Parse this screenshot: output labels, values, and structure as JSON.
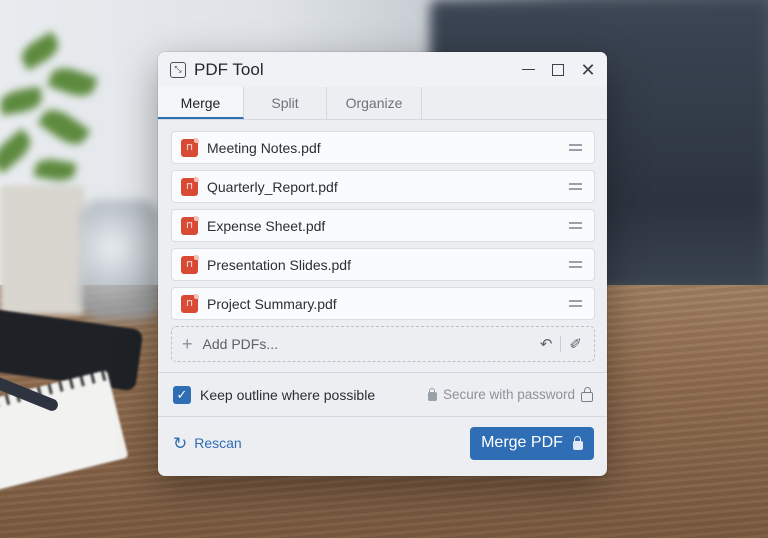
{
  "window": {
    "title": "PDF Tool"
  },
  "tabs": [
    {
      "label": "Merge",
      "active": true
    },
    {
      "label": "Split",
      "active": false
    },
    {
      "label": "Organize",
      "active": false
    }
  ],
  "files": [
    {
      "name": "Meeting Notes.pdf"
    },
    {
      "name": "Quarterly_Report.pdf"
    },
    {
      "name": "Expense Sheet.pdf"
    },
    {
      "name": "Presentation Slides.pdf"
    },
    {
      "name": "Project Summary.pdf"
    }
  ],
  "add": {
    "label": "Add PDFs..."
  },
  "options": {
    "keep_outline_label": "Keep outline where possible",
    "keep_outline_checked": true,
    "secure_label": "Secure with password"
  },
  "footer": {
    "rescan_label": "Rescan",
    "merge_label": "Merge PDF"
  },
  "colors": {
    "accent": "#2f6db5",
    "pdf_icon": "#d94a35"
  },
  "icons": [
    "pdf-tool-app-icon",
    "minimize-icon",
    "maximize-icon",
    "close-icon",
    "pdf-file-icon",
    "drag-handle-icon",
    "plus-icon",
    "undo-icon",
    "edit-icon",
    "checkbox-checked-icon",
    "lock-icon",
    "refresh-icon"
  ]
}
